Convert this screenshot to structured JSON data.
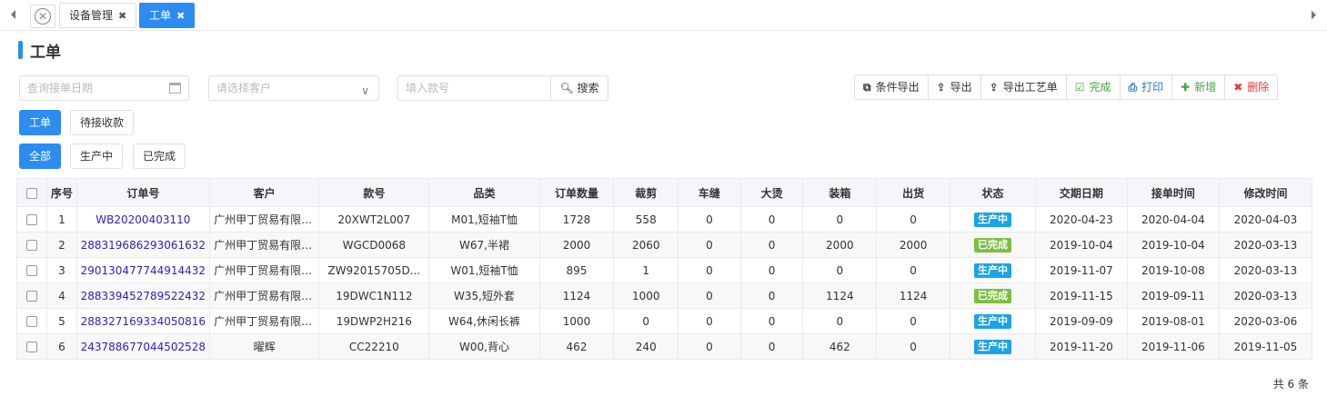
{
  "tabs": {
    "items": [
      {
        "label": "设备管理",
        "active": false
      },
      {
        "label": "工单",
        "active": true
      }
    ]
  },
  "page": {
    "title": "工单"
  },
  "filters": {
    "date_placeholder": "查询接单日期",
    "customer_placeholder": "请选择客户",
    "style_placeholder": "填入款号",
    "search_label": "搜索"
  },
  "actions": {
    "cond_export": "条件导出",
    "export": "导出",
    "export_process": "导出工艺单",
    "complete": "完成",
    "print": "打印",
    "add": "新增",
    "delete": "删除"
  },
  "type_tabs": [
    {
      "label": "工单",
      "active": true
    },
    {
      "label": "待接收款",
      "active": false
    }
  ],
  "status_tabs": [
    {
      "label": "全部",
      "active": true
    },
    {
      "label": "生产中",
      "active": false
    },
    {
      "label": "已完成",
      "active": false
    }
  ],
  "table": {
    "headers": [
      "序号",
      "订单号",
      "客户",
      "款号",
      "品类",
      "订单数量",
      "裁剪",
      "车缝",
      "大烫",
      "装箱",
      "出货",
      "状态",
      "交期日期",
      "接单时间",
      "修改时间"
    ],
    "rows": [
      [
        "1",
        "WB20200403110",
        "广州甲丁贸易有限公司",
        "20XWT2L007",
        "M01,短袖T恤",
        "1728",
        "558",
        "0",
        "0",
        "0",
        "0",
        "生产中",
        "2020-04-23",
        "2020-04-04",
        "2020-04-03"
      ],
      [
        "2",
        "288319686293061632",
        "广州甲丁贸易有限公司",
        "WGCD0068",
        "W67,半裙",
        "2000",
        "2060",
        "0",
        "0",
        "2000",
        "2000",
        "已完成",
        "2019-10-04",
        "2019-10-04",
        "2020-03-13"
      ],
      [
        "3",
        "290130477744914432",
        "广州甲丁贸易有限公司",
        "ZW92015705D...",
        "W01,短袖T恤",
        "895",
        "1",
        "0",
        "0",
        "0",
        "0",
        "生产中",
        "2019-11-07",
        "2019-10-08",
        "2020-03-13"
      ],
      [
        "4",
        "288339452789522432",
        "广州甲丁贸易有限公司",
        "19DWC1N112",
        "W35,短外套",
        "1124",
        "1000",
        "0",
        "0",
        "1124",
        "1124",
        "已完成",
        "2019-11-15",
        "2019-09-11",
        "2020-03-13"
      ],
      [
        "5",
        "288327169334050816",
        "广州甲丁贸易有限公司",
        "19DWP2H216",
        "W64,休闲长裤",
        "1000",
        "0",
        "0",
        "0",
        "0",
        "0",
        "生产中",
        "2019-09-09",
        "2019-08-01",
        "2020-03-06"
      ],
      [
        "6",
        "243788677044502528",
        "曜辉",
        "CC22210",
        "W00,背心",
        "462",
        "240",
        "0",
        "0",
        "462",
        "0",
        "生产中",
        "2019-11-20",
        "2019-11-06",
        "2019-11-05"
      ]
    ]
  },
  "status_colors": {
    "生产中": "#1aa3e8",
    "已完成": "#7cbf41"
  },
  "footer": {
    "total": "共 6 条"
  }
}
